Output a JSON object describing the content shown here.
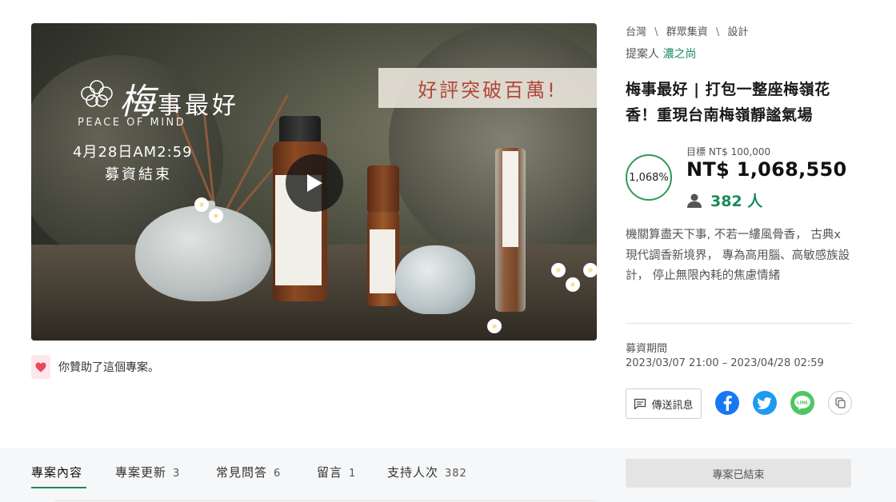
{
  "hero": {
    "title_cn_first": "梅",
    "title_cn_rest": "事最好",
    "title_en": "PEACE OF MIND",
    "date_line": "4月28日AM2:59",
    "end_line": "募資結束",
    "banner": "好評突破百萬!",
    "play_icon": "play-icon"
  },
  "supported_notice": "你贊助了這個專案。",
  "breadcrumb": [
    "台灣",
    "群眾集資",
    "設計"
  ],
  "breadcrumb_separator": "\\",
  "proposer": {
    "label": "提案人",
    "name": "濃之尚"
  },
  "project": {
    "title": "梅事最好 | 打包一整座梅嶺花香！重現台南梅嶺靜謐氣場",
    "progress_percent": "1,068%",
    "goal": "目標 NT$ 100,000",
    "amount": "NT$ 1,068,550",
    "backers": "382 人",
    "description": "機關算盡天下事, 不若一縷風骨香， 古典x現代調香新境界， 專為高用腦、高敏感族設計， 停止無限內耗的焦慮情緒"
  },
  "period": {
    "label": "募資期間",
    "value": "2023/03/07 21:00 – 2023/04/28 02:59"
  },
  "actions": {
    "message_label": "傳送訊息"
  },
  "tabs": [
    {
      "label": "專案內容",
      "count": ""
    },
    {
      "label": "專案更新",
      "count": "3"
    },
    {
      "label": "常見問答",
      "count": "6"
    },
    {
      "label": "留言",
      "count": "1"
    },
    {
      "label": "支持人次",
      "count": "382"
    }
  ],
  "ended_button": "專案已結束",
  "colors": {
    "accent_green": "#1a8a5a",
    "ring_green": "#2e9a55",
    "banner_red": "#b0473a",
    "heart_pink": "#e8485a"
  }
}
